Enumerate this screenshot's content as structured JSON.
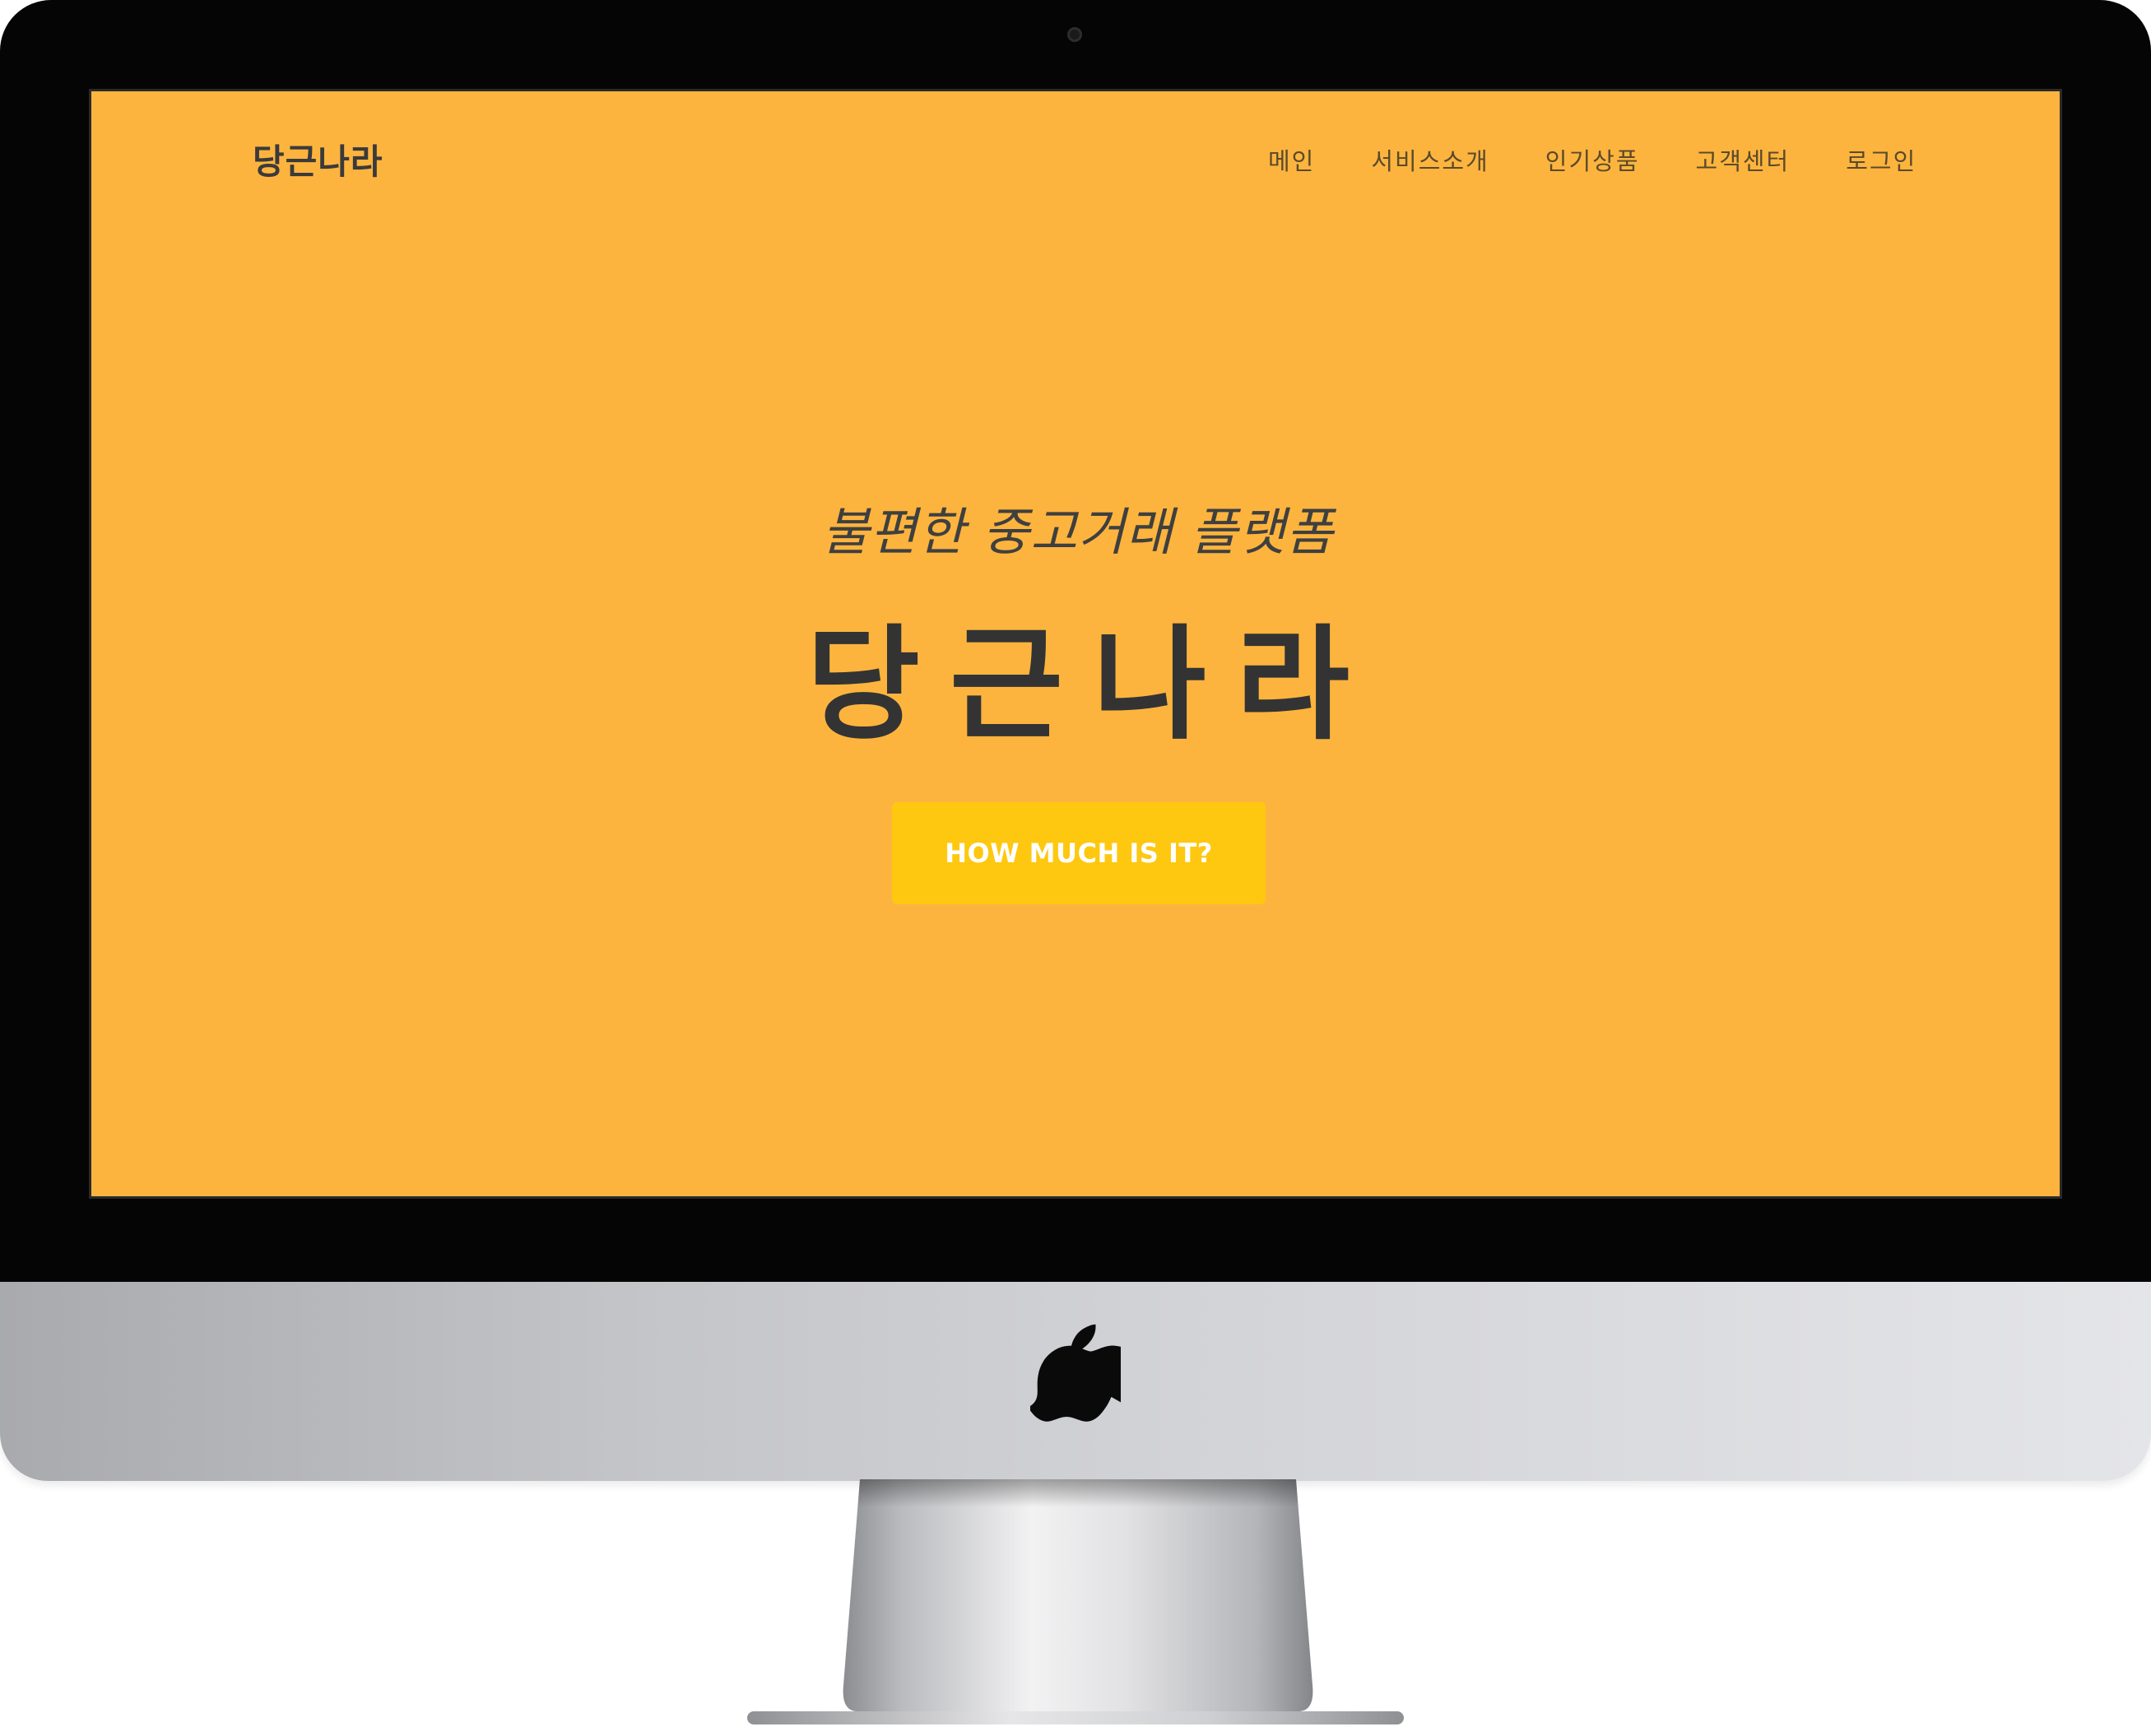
{
  "header": {
    "brand": "당근나라",
    "nav": [
      {
        "label": "메인"
      },
      {
        "label": "서비스소개"
      },
      {
        "label": "인기상품"
      },
      {
        "label": "고객센터"
      },
      {
        "label": "로그인"
      }
    ]
  },
  "hero": {
    "tagline": "불편한 중고거래 플랫폼",
    "title": "당근나라",
    "cta_label": "HOW MUCH IS IT?"
  },
  "colors": {
    "background": "#fdb43e",
    "cta": "#fec810",
    "text_dark": "#333333"
  },
  "icons": {
    "chin_logo": "apple-logo-icon",
    "camera": "webcam-icon"
  }
}
